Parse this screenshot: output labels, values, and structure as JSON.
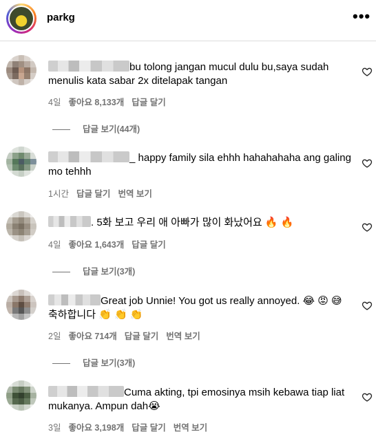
{
  "header": {
    "username": "parkg",
    "more_icon": "more-horizontal-icon"
  },
  "comments": [
    {
      "text": "bu tolong jangan mucul dulu bu,saya sudah menulis kata sabar 2x ditelapak tangan",
      "time": "4일",
      "likes": "좋아요 8,133개",
      "reply": "답글 달기",
      "view_replies": "답글 보기(44개)"
    },
    {
      "text": "_ happy family sila ehhh hahahahaha ang galing mo tehhh",
      "time": "1시간",
      "reply": "답글 달기",
      "translate": "번역 보기"
    },
    {
      "text": ". 5화 보고 우리 애 아빠가 많이 화났어요 🔥 🔥",
      "time": "4일",
      "likes": "좋아요 1,643개",
      "reply": "답글 달기",
      "view_replies": "답글 보기(3개)"
    },
    {
      "text": "Great job Unnie! You got us really annoyed. 😂 😡 😅 축하합니다 👏 👏 👏",
      "time": "2일",
      "likes": "좋아요 714개",
      "reply": "답글 달기",
      "translate": "번역 보기",
      "view_replies": "답글 보기(3개)"
    },
    {
      "text": "Cuma akting, tpi emosinya msih kebawa tiap liat mukanya. Ampun dah😭",
      "time": "3일",
      "likes": "좋아요 3,198개",
      "reply": "답글 달기",
      "translate": "번역 보기"
    }
  ],
  "icons": {
    "like": "heart-outline-icon"
  }
}
